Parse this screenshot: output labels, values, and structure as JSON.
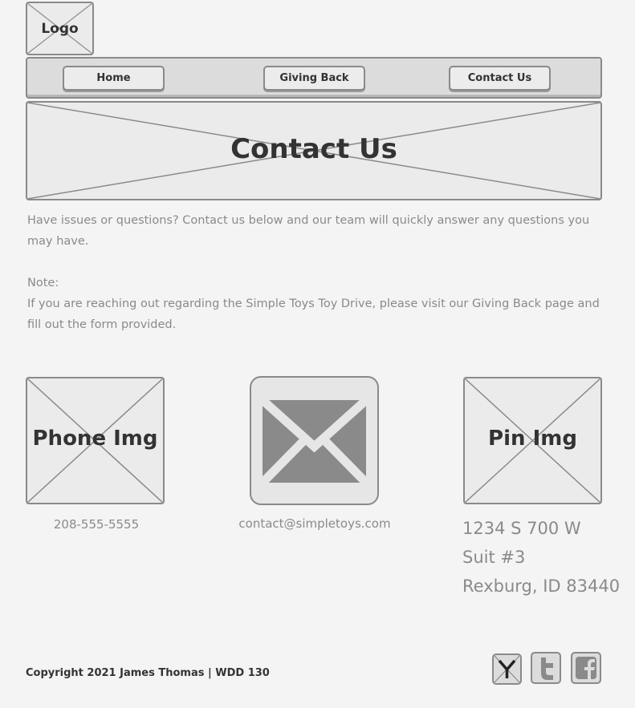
{
  "header": {
    "logo_label": "Logo"
  },
  "nav": {
    "items": [
      {
        "label": "Home"
      },
      {
        "label": "Giving Back"
      },
      {
        "label": "Contact Us"
      }
    ]
  },
  "banner": {
    "title": "Contact Us"
  },
  "main": {
    "intro": "Have issues or questions? Contact us below and our team will quickly answer any questions you may have.",
    "note_label": "Note:",
    "note_text": "If you are reaching out regarding the Simple Toys Toy Drive, please visit our Giving Back page and fill out the form provided."
  },
  "contact": {
    "phone_img_label": "Phone Img",
    "phone": "208-555-5555",
    "email_icon": "envelope-icon",
    "email": "contact@simpletoys.com",
    "pin_img_label": "Pin Img",
    "address_lines": [
      "1234 S 700 W",
      "Suit #3",
      "Rexburg, ID 83440"
    ]
  },
  "footer": {
    "copyright": "Copyright 2021 James Thomas | WDD 130",
    "social_icons": [
      "yahoo-icon",
      "twitter-icon",
      "facebook-icon"
    ]
  },
  "colors": {
    "background": "#f4f4f4",
    "placeholder_fill": "#ebebeb",
    "border": "#8a8a8a",
    "muted_text": "#8a8a8a",
    "dark_text": "#333333"
  }
}
